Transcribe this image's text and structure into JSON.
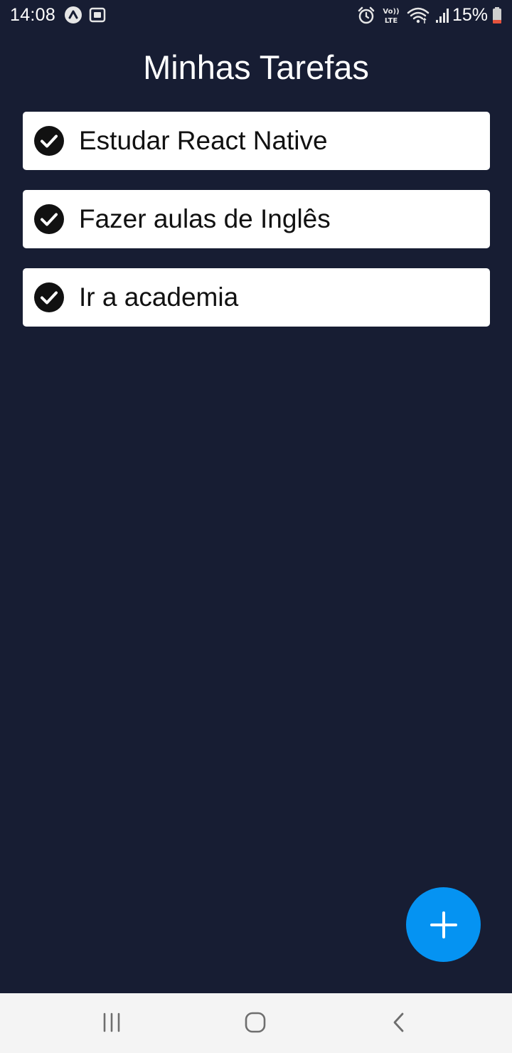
{
  "status_bar": {
    "time": "14:08",
    "battery_percent": "15%",
    "left_icons": [
      "nav-app-icon",
      "screenshot-icon"
    ],
    "right_icons": [
      "alarm-icon",
      "volte-icon",
      "wifi-icon",
      "signal-icon",
      "battery-low-icon"
    ],
    "volte_line1": "Vo))",
    "volte_line2": "LTE"
  },
  "header": {
    "title": "Minhas Tarefas"
  },
  "tasks": [
    {
      "label": "Estudar React Native",
      "done": true
    },
    {
      "label": "Fazer aulas de Inglês",
      "done": true
    },
    {
      "label": "Ir a academia",
      "done": true
    }
  ],
  "fab": {
    "icon": "plus-icon",
    "color": "#0593f2"
  },
  "navigation_bar": {
    "buttons": [
      "recent-apps-icon",
      "home-icon",
      "back-icon"
    ]
  },
  "colors": {
    "background": "#171d33",
    "card": "#ffffff",
    "check": "#111111",
    "accent": "#0593f2",
    "battery_low": "#e5533d"
  }
}
